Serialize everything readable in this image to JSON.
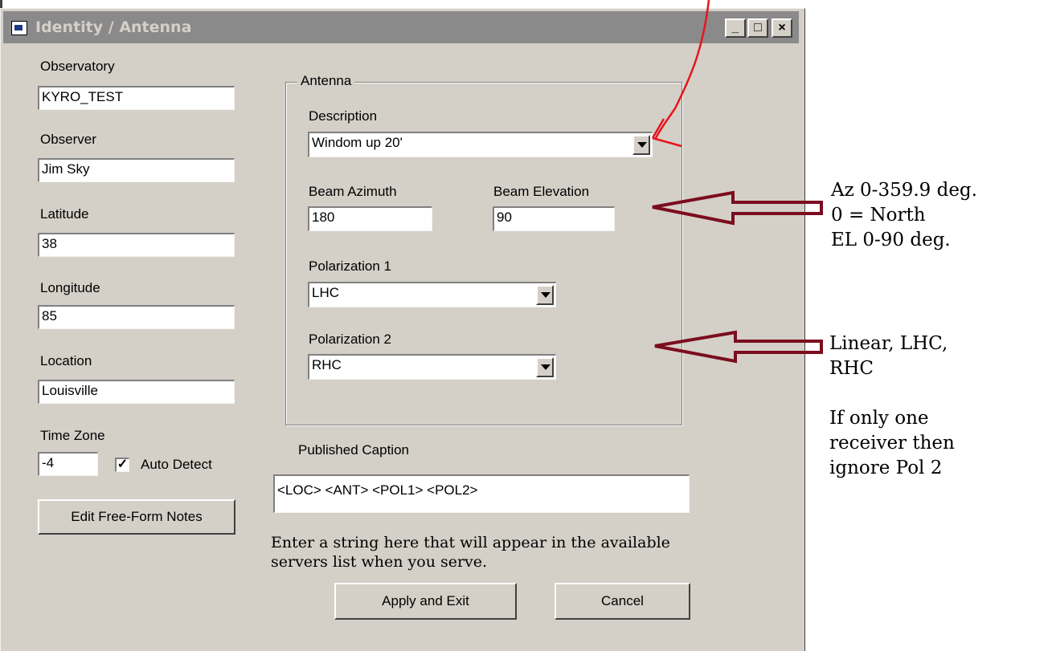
{
  "window": {
    "title": "Identity / Antenna",
    "minimize": "_",
    "maximize": "□",
    "close": "×"
  },
  "left": {
    "observatory_label": "Observatory",
    "observatory_value": "KYRO_TEST",
    "observer_label": "Observer",
    "observer_value": "Jim Sky",
    "latitude_label": "Latitude",
    "latitude_value": "38",
    "longitude_label": "Longitude",
    "longitude_value": "85",
    "location_label": "Location",
    "location_value": "Louisville",
    "timezone_label": "Time Zone",
    "timezone_value": "-4",
    "auto_detect_label": "Auto Detect",
    "auto_detect_checked": true,
    "notes_button": "Edit Free-Form Notes"
  },
  "antenna": {
    "group_title": "Antenna",
    "description_label": "Description",
    "description_value": "Windom up 20'",
    "azimuth_label": "Beam Azimuth",
    "azimuth_value": "180",
    "elevation_label": "Beam Elevation",
    "elevation_value": "90",
    "pol1_label": "Polarization 1",
    "pol1_value": "LHC",
    "pol2_label": "Polarization 2",
    "pol2_value": "RHC"
  },
  "caption": {
    "label": "Published Caption",
    "value": "<LOC>  <ANT>  <POL1>  <POL2>",
    "hint": "Enter a string here that will appear in the available servers list when you serve."
  },
  "buttons": {
    "apply": "Apply and  Exit",
    "cancel": "Cancel"
  },
  "annotations": {
    "az_note": "Az 0-359.9 deg.\n0 = North\nEL 0-90 deg.",
    "pol_note": "Linear, LHC,\nRHC\n\nIf only one\nreceiver then\nignore Pol 2",
    "arrow_color": "#7b0d1e",
    "pen_color": "#e8141c"
  },
  "colors": {
    "window_bg": "#d4d0c8",
    "titlebar_inactive": "#8a8a8a"
  }
}
